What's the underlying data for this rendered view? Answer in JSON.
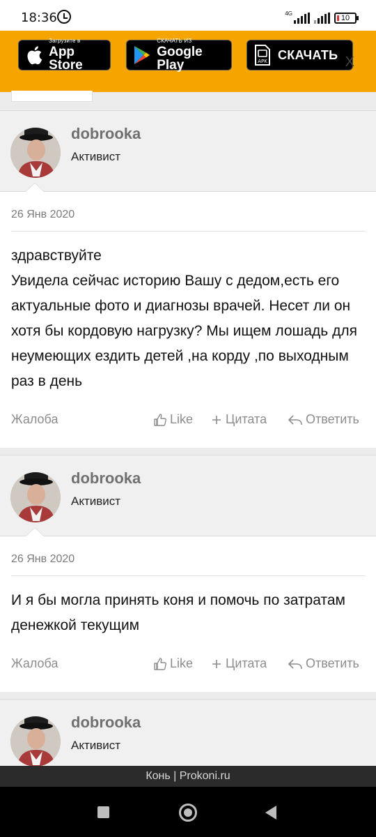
{
  "status": {
    "time": "18:36",
    "network": "4G",
    "battery": "10"
  },
  "banner": {
    "apple": {
      "small": "Загрузите в",
      "big": "App Store"
    },
    "google": {
      "small": "СКАЧАТЬ ИЗ",
      "big": "Google Play"
    },
    "apk": {
      "label": "СКАЧАТЬ",
      "badge": "APK"
    },
    "close": "X"
  },
  "posts": [
    {
      "user": "dobrooka",
      "role": "Активист",
      "date": "26 Янв 2020",
      "text": "здравствуйте\nУвидела сейчас историю Вашу с дедом,есть его актуальные фото и диагнозы врачей. Несет ли он хотя бы кордовую нагрузку? Мы ищем лошадь для неумеющих ездить детей ,на корду ,по выходным раз в день"
    },
    {
      "user": "dobrooka",
      "role": "Активист",
      "date": "26 Янв 2020",
      "text": "И я бы могла принять коня и помочь по затратам денежкой текущим"
    },
    {
      "user": "dobrooka",
      "role": "Активист"
    }
  ],
  "actions": {
    "complaint": "Жалоба",
    "like": "Like",
    "quote": "Цитата",
    "reply": "Ответить"
  },
  "footer": {
    "text": "Конь | Prokoni.ru"
  },
  "colors": {
    "banner": "#f6a500",
    "username": "#707070",
    "action": "#8c8c8c"
  }
}
